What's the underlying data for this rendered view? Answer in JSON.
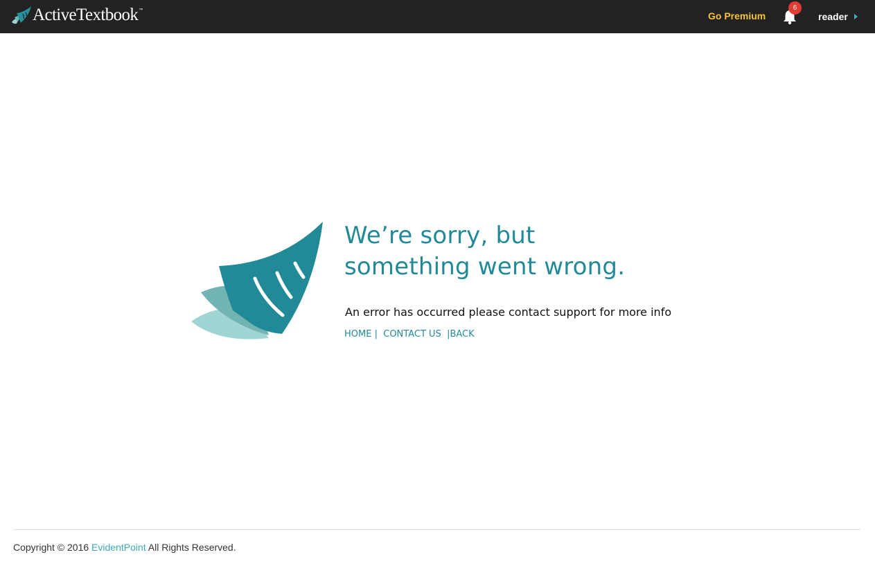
{
  "header": {
    "brand": {
      "name": "ActiveTextbook",
      "trademark": "™",
      "logo_icon": "book-pages-logo-icon"
    },
    "go_premium_label": "Go Premium",
    "notifications": {
      "icon": "bell-icon",
      "count": "6"
    },
    "user": {
      "name": "reader",
      "caret_icon": "caret-right-icon"
    }
  },
  "error": {
    "logo_icon": "book-pages-logo-icon",
    "headline_line1": "We’re sorry, but",
    "headline_line2": "something went wrong.",
    "message": "An error has occurred please contact support for more info",
    "links": {
      "home": "HOME",
      "sep1": "|",
      "contact": "CONTACT US",
      "sep2": "|",
      "back": "BACK"
    }
  },
  "footer": {
    "prefix": "Copyright © 2016",
    "company": "EvidentPoint",
    "suffix": "All Rights Reserved."
  },
  "colors": {
    "topbar_bg": "#222222",
    "accent_teal": "#228a97",
    "premium_yellow": "#f6c335",
    "badge_red": "#e23c34",
    "link_teal": "#3ea9b0"
  }
}
